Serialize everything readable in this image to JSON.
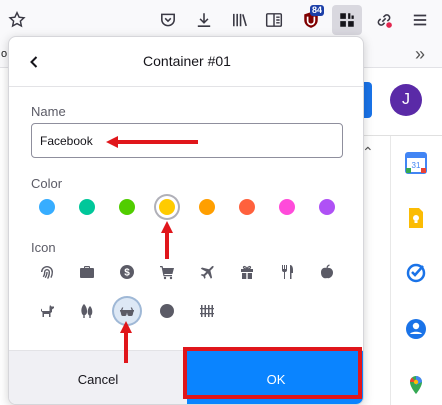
{
  "toolbar": {
    "icons": [
      "bookmark-star-icon",
      "pocket-icon",
      "download-icon",
      "library-icon",
      "reader-view-icon",
      "ublock-icon",
      "containers-icon",
      "unlink-icon",
      "menu-icon"
    ],
    "badge_count": "84"
  },
  "background": {
    "avatar_letter": "J",
    "left_text": "o",
    "side_icons": [
      "calendar-icon",
      "keep-icon",
      "tasks-icon",
      "contacts-icon",
      "maps-icon"
    ],
    "calendar_day": "31",
    "colors": {
      "blue": "#1a73e8",
      "avatar": "#5a2aa7"
    }
  },
  "panel": {
    "title": "Container #01",
    "name_label": "Name",
    "name_value": "Facebook",
    "color_label": "Color",
    "icon_label": "Icon",
    "colors": [
      {
        "name": "blue",
        "hex": "#37adff"
      },
      {
        "name": "turquoise",
        "hex": "#00c79a"
      },
      {
        "name": "green",
        "hex": "#51cd00"
      },
      {
        "name": "yellow",
        "hex": "#ffcb00"
      },
      {
        "name": "orange",
        "hex": "#ff9f00"
      },
      {
        "name": "red",
        "hex": "#ff613d"
      },
      {
        "name": "pink",
        "hex": "#ff4bda"
      },
      {
        "name": "purple",
        "hex": "#af51f5"
      }
    ],
    "selected_color": "yellow",
    "icons": [
      "fingerprint-icon",
      "briefcase-icon",
      "dollar-icon",
      "cart-icon",
      "vacation-icon",
      "gift-icon",
      "food-icon",
      "fruit-icon",
      "pet-icon",
      "tree-icon",
      "chill-icon",
      "circle-icon",
      "fence-icon"
    ],
    "selected_icon": "chill-icon",
    "cancel_label": "Cancel",
    "ok_label": "OK",
    "accent": "#0a84ff",
    "annotation_color": "#e0161b"
  }
}
